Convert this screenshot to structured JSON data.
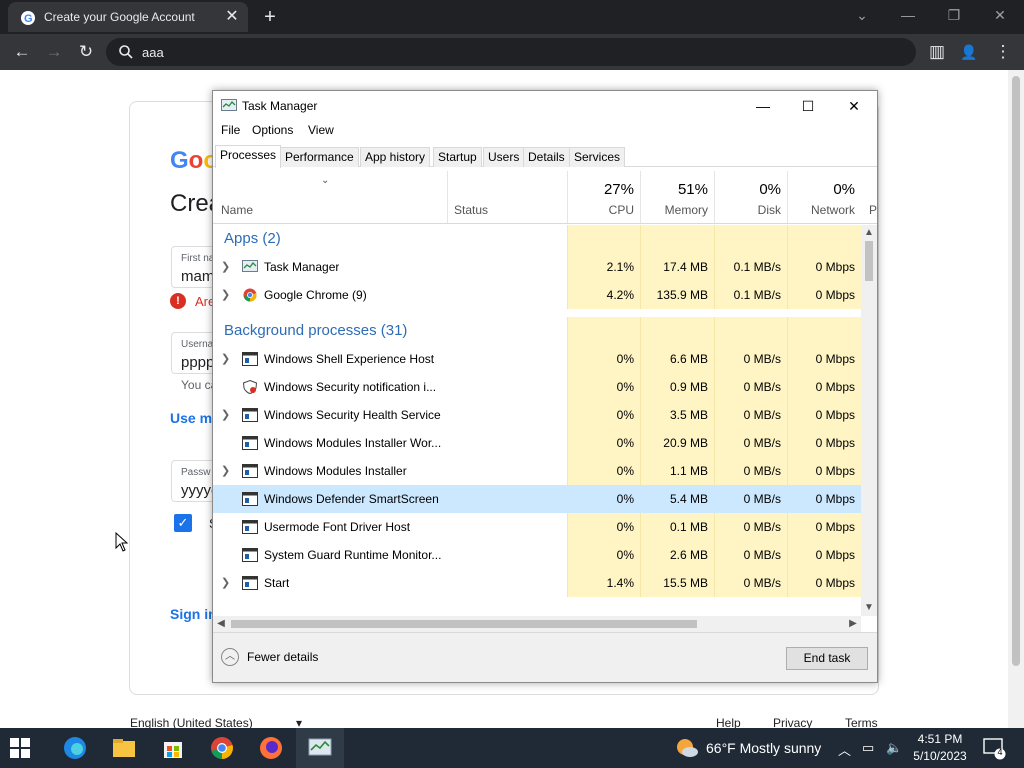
{
  "browser": {
    "tab_title": "Create your Google Account",
    "tab_close": "✕",
    "new_tab": "+",
    "minimize": "—",
    "restore": "❐",
    "close": "✕",
    "tab_search": "⌄",
    "back": "←",
    "forward": "→",
    "reload": "↻",
    "address": "aaa",
    "sidebar_icon": "▥",
    "profile_icon": "👤",
    "menu_icon": "⋮"
  },
  "page": {
    "logo": "Goo",
    "heading": "Crea",
    "first_name_label": "First na",
    "first_name_value": "mam",
    "error_text": "Are",
    "username_label": "Userna",
    "username_value": "pppp",
    "helper_text": "You ca",
    "use_link": "Use m",
    "password_label": "Passw",
    "password_value": "yyyye",
    "checkbox_trail": "S",
    "signin_link": "Sign in",
    "footer_language": "English (United States)",
    "footer_help": "Help",
    "footer_privacy": "Privacy",
    "footer_terms": "Terms"
  },
  "task_manager": {
    "title": "Task Manager",
    "menu": [
      "File",
      "Options",
      "View"
    ],
    "tabs": [
      "Processes",
      "Performance",
      "App history",
      "Startup",
      "Users",
      "Details",
      "Services"
    ],
    "header": {
      "name": "Name",
      "status": "Status",
      "cpu_pct": "27%",
      "cpu": "CPU",
      "memory_pct": "51%",
      "memory": "Memory",
      "disk_pct": "0%",
      "disk": "Disk",
      "network_pct": "0%",
      "network": "Network",
      "cutoff": "P"
    },
    "groups": {
      "apps": "Apps (2)",
      "background": "Background processes (31)"
    },
    "rows": [
      {
        "name": "Task Manager",
        "cpu": "2.1%",
        "mem": "17.4 MB",
        "disk": "0.1 MB/s",
        "net": "0 Mbps"
      },
      {
        "name": "Google Chrome (9)",
        "cpu": "4.2%",
        "mem": "135.9 MB",
        "disk": "0.1 MB/s",
        "net": "0 Mbps"
      },
      {
        "name": "Windows Shell Experience Host",
        "cpu": "0%",
        "mem": "6.6 MB",
        "disk": "0 MB/s",
        "net": "0 Mbps"
      },
      {
        "name": "Windows Security notification i...",
        "cpu": "0%",
        "mem": "0.9 MB",
        "disk": "0 MB/s",
        "net": "0 Mbps"
      },
      {
        "name": "Windows Security Health Service",
        "cpu": "0%",
        "mem": "3.5 MB",
        "disk": "0 MB/s",
        "net": "0 Mbps"
      },
      {
        "name": "Windows Modules Installer Wor...",
        "cpu": "0%",
        "mem": "20.9 MB",
        "disk": "0 MB/s",
        "net": "0 Mbps"
      },
      {
        "name": "Windows Modules Installer",
        "cpu": "0%",
        "mem": "1.1 MB",
        "disk": "0 MB/s",
        "net": "0 Mbps"
      },
      {
        "name": "Windows Defender SmartScreen",
        "cpu": "0%",
        "mem": "5.4 MB",
        "disk": "0 MB/s",
        "net": "0 Mbps"
      },
      {
        "name": "Usermode Font Driver Host",
        "cpu": "0%",
        "mem": "0.1 MB",
        "disk": "0 MB/s",
        "net": "0 Mbps"
      },
      {
        "name": "System Guard Runtime Monitor...",
        "cpu": "0%",
        "mem": "2.6 MB",
        "disk": "0 MB/s",
        "net": "0 Mbps"
      },
      {
        "name": "Start",
        "cpu": "1.4%",
        "mem": "15.5 MB",
        "disk": "0 MB/s",
        "net": "0 Mbps"
      }
    ],
    "fewer_details": "Fewer details",
    "end_task": "End task"
  },
  "taskbar": {
    "weather": "66°F  Mostly sunny",
    "time": "4:51 PM",
    "date": "5/10/2023",
    "notifications": "4"
  }
}
